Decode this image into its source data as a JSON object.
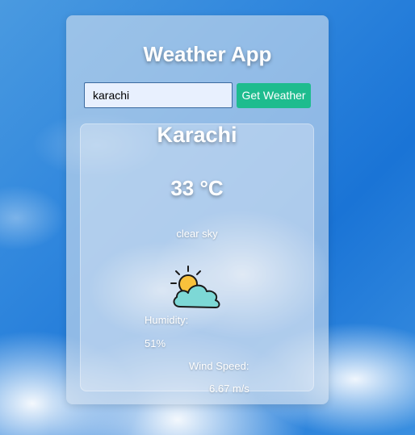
{
  "app": {
    "title": "Weather App"
  },
  "search": {
    "value": "karachi",
    "button_label": "Get Weather"
  },
  "weather": {
    "city": "Karachi",
    "temperature": "33 °C",
    "description": "clear sky",
    "icon": "partly-cloudy-icon",
    "humidity_label": "Humidity:",
    "humidity_value": "51%",
    "wind_label": "Wind Speed:",
    "wind_value": "6.67 m/s"
  },
  "colors": {
    "button": "#1ebc8e",
    "sun": "#f9c23c",
    "cloud": "#7dd8d6"
  }
}
